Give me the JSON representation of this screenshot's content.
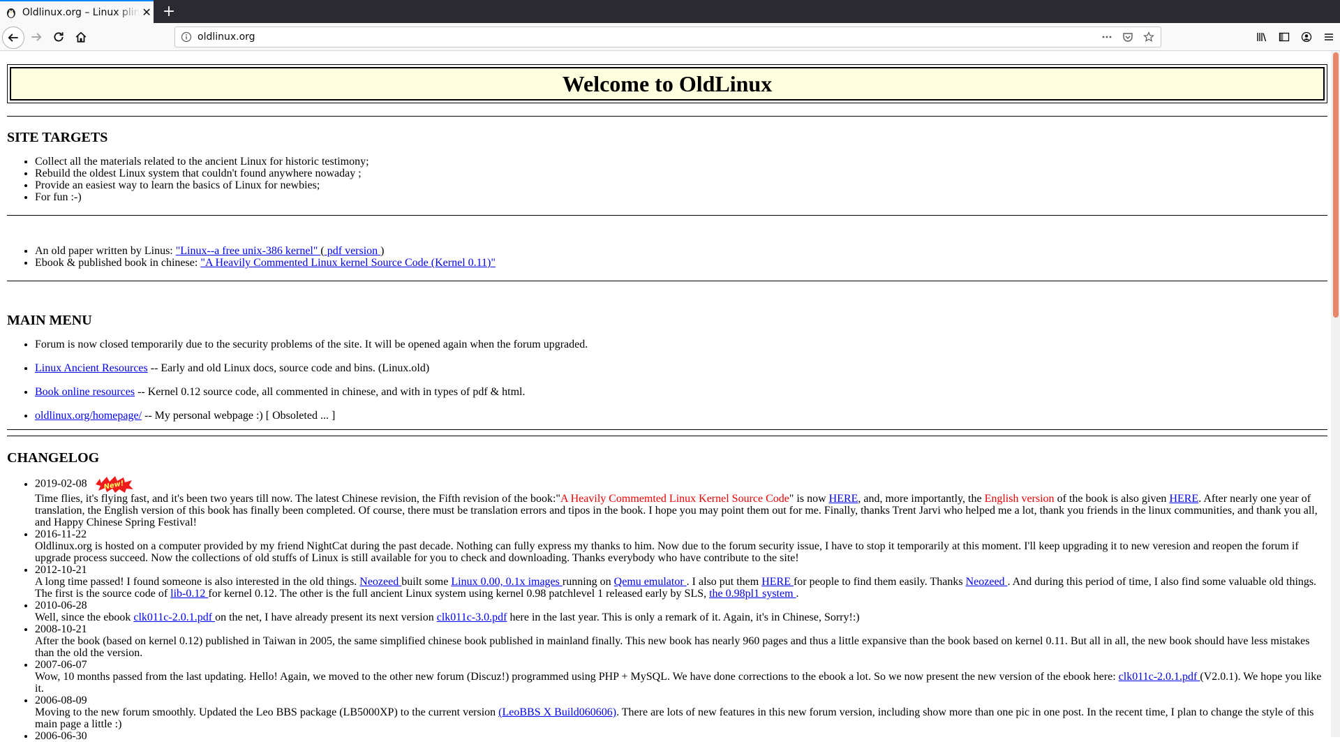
{
  "browser": {
    "tab_title": "Oldlinux.org – Linux plinth",
    "url": "oldlinux.org"
  },
  "page": {
    "banner_title": "Welcome to OldLinux",
    "site_targets": {
      "heading": "SITE TARGETS",
      "items": [
        "Collect all the materials related to the ancient Linux for historic testimony;",
        "Rebuild the oldest Linux system that couldn't found anywhere nowaday ;",
        "Provide an easiest way to learn the basics of Linux for newbies;",
        "For fun :-)"
      ]
    },
    "papers": {
      "paper_prefix": "An old paper written by Linus: ",
      "paper_link": "\"Linux--a free unix-386 kernel\" ",
      "paper_open": "(",
      "paper_pdf_link": " pdf version ",
      "paper_close": ")",
      "ebook_prefix": "Ebook & published book in chinese: ",
      "ebook_link": "\"A Heavily Commented Linux kernel Source Code (Kernel 0.11)\""
    },
    "main_menu": {
      "heading": "MAIN MENU",
      "forum_notice": "Forum is now closed temporarily due to the security problems of the site. It will be opened again when the forum upgraded.",
      "items": [
        {
          "link": "Linux Ancient Resources",
          "desc": " -- Early and old Linux docs, source code and bins. (Linux.old)"
        },
        {
          "link": "Book online resources",
          "desc": " -- Kernel 0.12 source code, all commented in chinese, and with in types of pdf & html."
        },
        {
          "link": "oldlinux.org/homepage/",
          "desc": " -- My personal webpage :) [ Obsoleted ... ]"
        }
      ]
    },
    "changelog": {
      "heading": "CHANGELOG",
      "new_badge": "New!",
      "e1_date": "2019-02-08",
      "e1_t1": "Time flies, it's flying fast, and it's been two years till now. The latest Chinese revision, the Fifth revision of the book:\"",
      "e1_red1": "A Heavily Commemted Linux Kernel Source Code",
      "e1_t2": "\" is now ",
      "e1_here1": "HERE",
      "e1_t3": ", and, more importantly, the ",
      "e1_red2": "English version",
      "e1_t4": " of the book is also given ",
      "e1_here2": "HERE",
      "e1_t5": ". After nearly one year of translation, the English version of this book has finally been completed. Of course, there must be translation errors and tipos in the book. I hope you may point them out for me. Finally, thanks Trent Jarvi who helped me a lot, thank you friends in the linux communities, and thank you all, and Happy Chinese Spring Festival!",
      "e2_date": "2016-11-22",
      "e2_text": "Oldlinux.org is hosted on a computer provided by my friend NightCat during the past decade. Nothing can fully express my thanks to him. Now due to the forum security issue, I have to stop it temporarily at this moment. I'll keep upgrading it to new veresion and reopen the forum if upgrade process succeed. Now the collections of old stuffs of Linux is still available for you to check and downloading. Thanks everybody who have contribute to the site!",
      "e3_date": "2012-10-21",
      "e3_t1": "A long time passed! I found someone is also interested in the old things. ",
      "e3_l1": "Neozeed ",
      "e3_t2": "built some ",
      "e3_l2": "Linux 0.00, 0.1x images ",
      "e3_t3": "running on ",
      "e3_l3": "Qemu emulator ",
      "e3_t4": ". I also put them ",
      "e3_l4": "HERE ",
      "e3_t5": "for people to find them easily. Thanks ",
      "e3_l5": "Neozeed ",
      "e3_t6": ". And during this period of time, I also find some valuable old things. The first is the source code of ",
      "e3_l6": "lib-0.12 ",
      "e3_t7": "for kernel 0.12. The other is the full ancient Linux system using kernel 0.98 patchlevel 1 released early by SLS, ",
      "e3_l7": "the 0.98pl1 system ",
      "e3_t8": ".",
      "e4_date": "2010-06-28",
      "e4_t1": "Well, since the ebook ",
      "e4_l1": "clk011c-2.0.1.pdf ",
      "e4_t2": "on the net, I have already present its next version ",
      "e4_l2": "clk011c-3.0.pdf",
      "e4_t3": " here in the last year. This is only a remark of it. Again, it's in Chinese, Sorry!:)",
      "e5_date": "2008-10-21",
      "e5_text": "After the book (based on kernel 0.12) published in Taiwan in 2005, the same simplified chinese book published in mainland finally. This new book has nearly 960 pages and thus a little expansive than the book based on kernel 0.11. But all in all, the new book should have less mistakes than the old the version.",
      "e6_date": "2007-06-07",
      "e6_t1": "Wow, 10 months passed from the last updating. Hello! Again, we moved to the other new forum (Discuz!) programmed using PHP + MySQL. We have done corrections to the ebook a lot. So we now present the new version of the ebook here: ",
      "e6_l1": "clk011c-2.0.1.pdf ",
      "e6_t2": "(V2.0.1). We hope you like it.",
      "e7_date": "2006-08-09",
      "e7_t1": "Moving to the new forum smoothly. Updated the Leo BBS package (LB5000XP) to the current version ",
      "e7_l1": "(LeoBBS X Build060606)",
      "e7_t2": ". There are lots of new features in this new forum version, including show more than one pic in one post. In the recent time, I plan to change the style of this main page a little :)",
      "e8_date": "2006-06-30"
    }
  }
}
